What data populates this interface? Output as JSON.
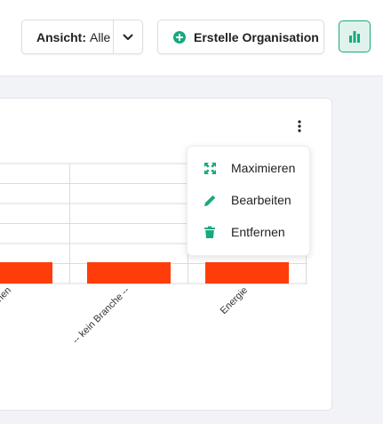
{
  "header": {
    "view_select": {
      "label": "Ansicht:",
      "value": "Alle"
    },
    "create_button_label": "Erstelle Organisation"
  },
  "chart_data": {
    "type": "bar",
    "categories": [
      "...hen",
      "-- kein Branche --",
      "Energie"
    ],
    "values": [
      1,
      1,
      1
    ],
    "grid": true,
    "bar_color": "#ff3d0a"
  },
  "menu": {
    "items": [
      {
        "label": "Maximieren",
        "icon": "maximize-icon"
      },
      {
        "label": "Bearbeiten",
        "icon": "pencil-icon"
      },
      {
        "label": "Entfernen",
        "icon": "trash-icon"
      }
    ]
  },
  "colors": {
    "accent": "#1aa880",
    "bar": "#ff3d0a"
  }
}
